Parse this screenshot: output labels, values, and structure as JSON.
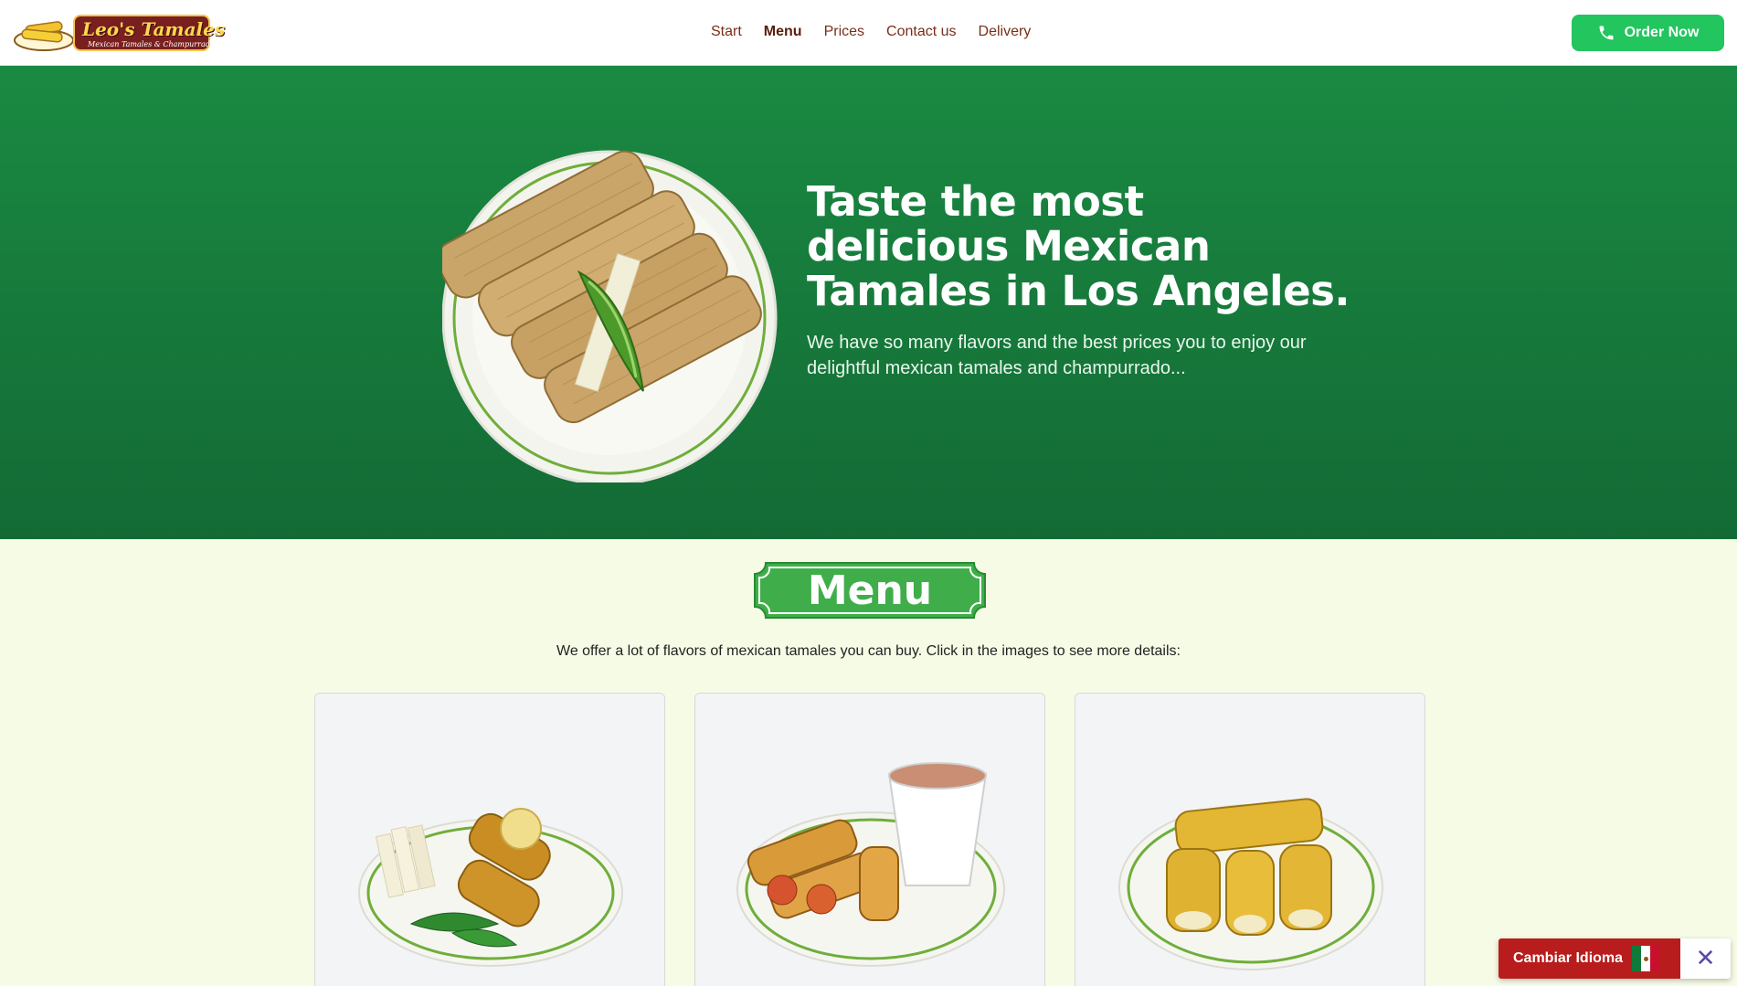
{
  "brand": {
    "name": "Leo's Tamales",
    "tagline": "Mexican Tamales & Champurrado"
  },
  "nav": {
    "items": [
      {
        "label": "Start",
        "active": false
      },
      {
        "label": "Menu",
        "active": true
      },
      {
        "label": "Prices",
        "active": false
      },
      {
        "label": "Contact us",
        "active": false
      },
      {
        "label": "Delivery",
        "active": false
      }
    ]
  },
  "header": {
    "order_button": "Order Now",
    "order_icon": "phone-icon"
  },
  "hero": {
    "title": "Taste the most delicious Mexican Tamales in Los Angeles.",
    "subtitle": "We have so many flavors and the best prices you to enjoy our delightful mexican tamales and champurrado..."
  },
  "menu": {
    "heading": "Menu",
    "intro": "We offer a lot of flavors of mexican tamales you can buy. Click in the images to see more details:"
  },
  "language_widget": {
    "label": "Cambiar Idioma",
    "flag_icon": "mexico-flag-icon",
    "close_icon": "close-icon",
    "close_glyph": "✕"
  },
  "colors": {
    "hero_green": "#1a8a42",
    "accent_green": "#22c55e",
    "nav_text": "#7a2e16",
    "section_bg": "#f6fbe6",
    "lang_red": "#b91c1c"
  }
}
